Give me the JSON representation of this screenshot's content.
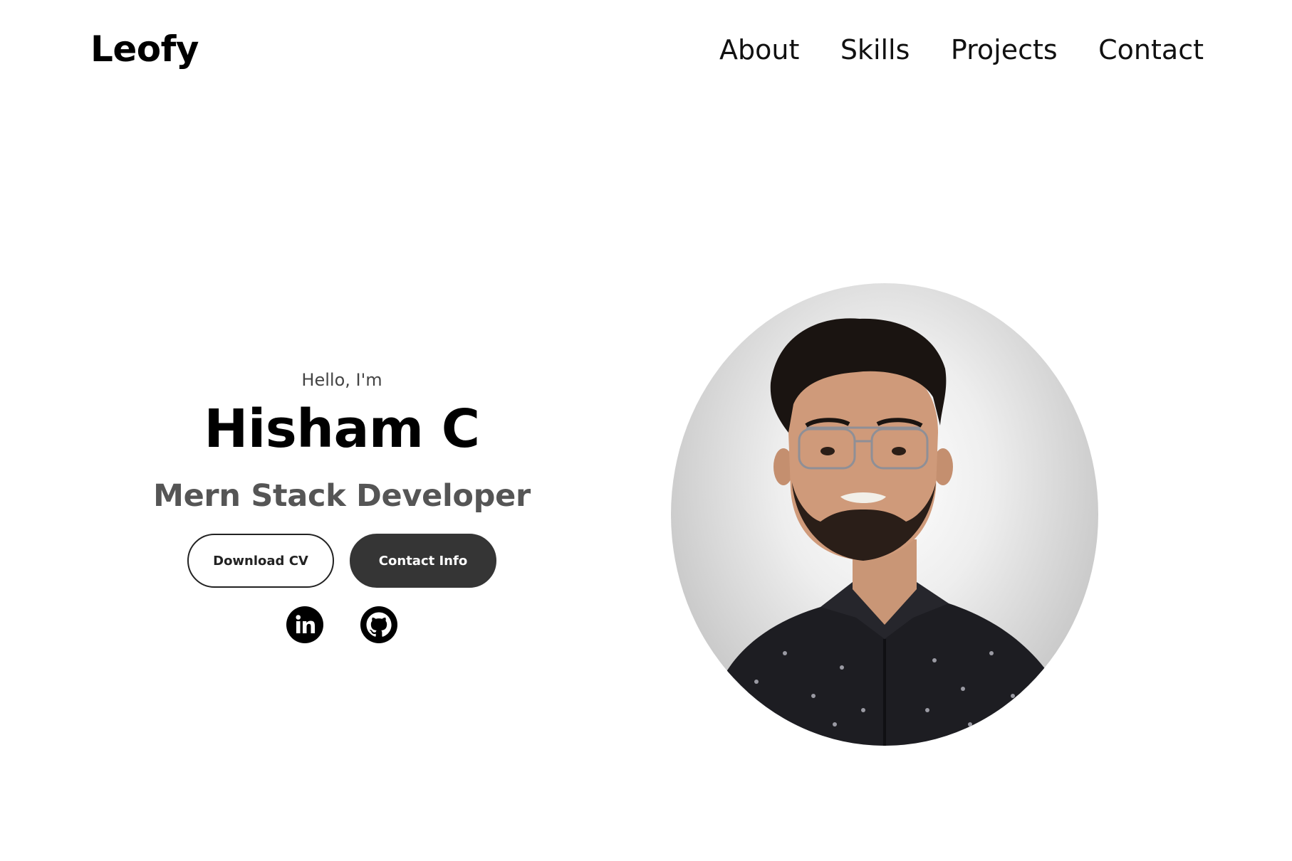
{
  "header": {
    "logo": "Leofy",
    "nav": [
      "About",
      "Skills",
      "Projects",
      "Contact"
    ]
  },
  "hero": {
    "greeting": "Hello, I'm",
    "name": "Hisham C",
    "role": "Mern Stack Developer",
    "buttons": {
      "download_cv": "Download CV",
      "contact_info": "Contact Info"
    },
    "socials": [
      "linkedin-icon",
      "github-icon"
    ]
  },
  "profile_photo": {
    "alt": "profile picture"
  }
}
